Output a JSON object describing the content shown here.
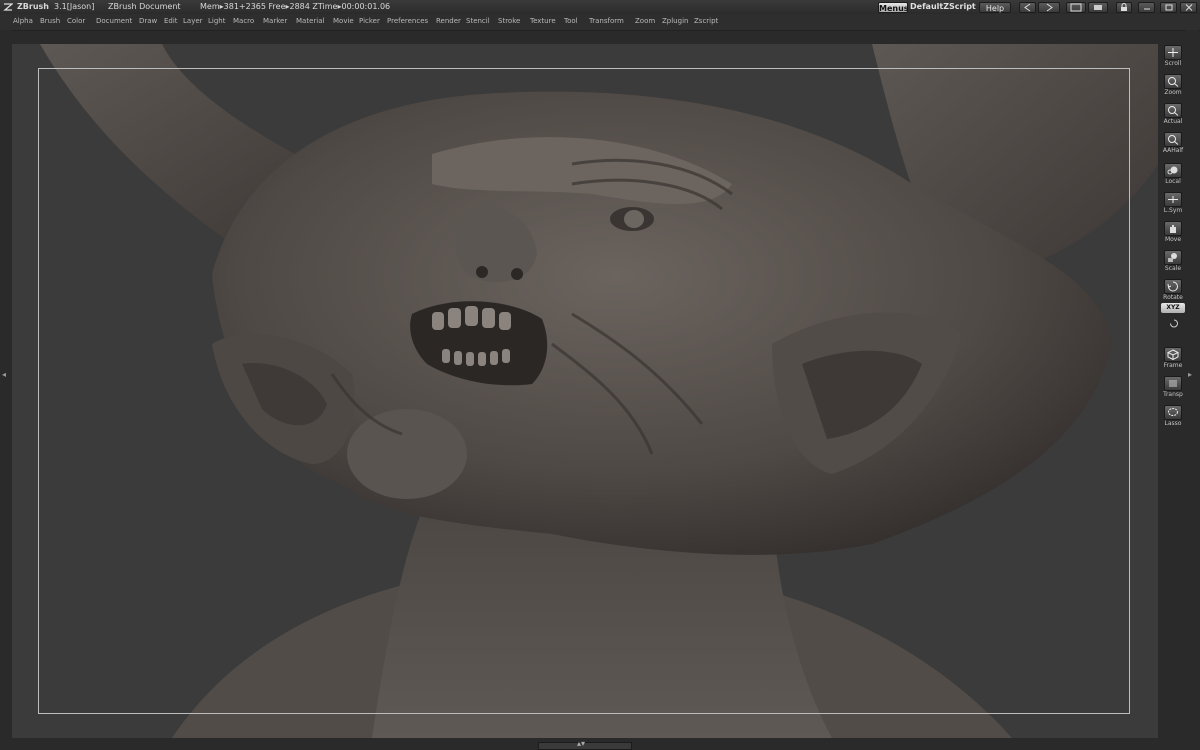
{
  "titlebar": {
    "app": "ZBrush",
    "version": "3.1[Jason]",
    "document": "ZBrush Document",
    "status": "Mem▸381+2365 Free▸2884 ZTime▸00:00:01.06",
    "menus_btn": "Menus",
    "script": "DefaultZScript",
    "help_btn": "Help"
  },
  "menubar": [
    "Alpha",
    "Brush",
    "Color",
    "Document",
    "Draw",
    "Edit",
    "Layer",
    "Light",
    "Macro",
    "Marker",
    "Material",
    "Movie",
    "Picker",
    "Preferences",
    "Render",
    "Stencil",
    "Stroke",
    "Texture",
    "Tool",
    "Transform",
    "Zoom",
    "Zplugin",
    "Zscript"
  ],
  "shelf": {
    "tools": [
      {
        "label": "Scroll",
        "icon": "scroll-icon"
      },
      {
        "label": "Zoom",
        "icon": "zoom-icon"
      },
      {
        "label": "Actual",
        "icon": "actual-icon"
      },
      {
        "label": "AAHalf",
        "icon": "aahalf-icon"
      },
      {
        "label": "Local",
        "icon": "local-icon"
      },
      {
        "label": "L.Sym",
        "icon": "lsym-icon"
      },
      {
        "label": "Move",
        "icon": "move-icon"
      },
      {
        "label": "Scale",
        "icon": "scale-icon"
      },
      {
        "label": "Rotate",
        "icon": "rotate-icon"
      },
      {
        "label": "Frame",
        "icon": "frame-icon"
      },
      {
        "label": "Transp",
        "icon": "transp-icon"
      },
      {
        "label": "Lasso",
        "icon": "lasso-icon"
      }
    ],
    "xyz": "XYZ"
  },
  "colors": {
    "bg": "#2a2a2a",
    "canvas": "#3b3b3b",
    "model": "#5a5450"
  }
}
